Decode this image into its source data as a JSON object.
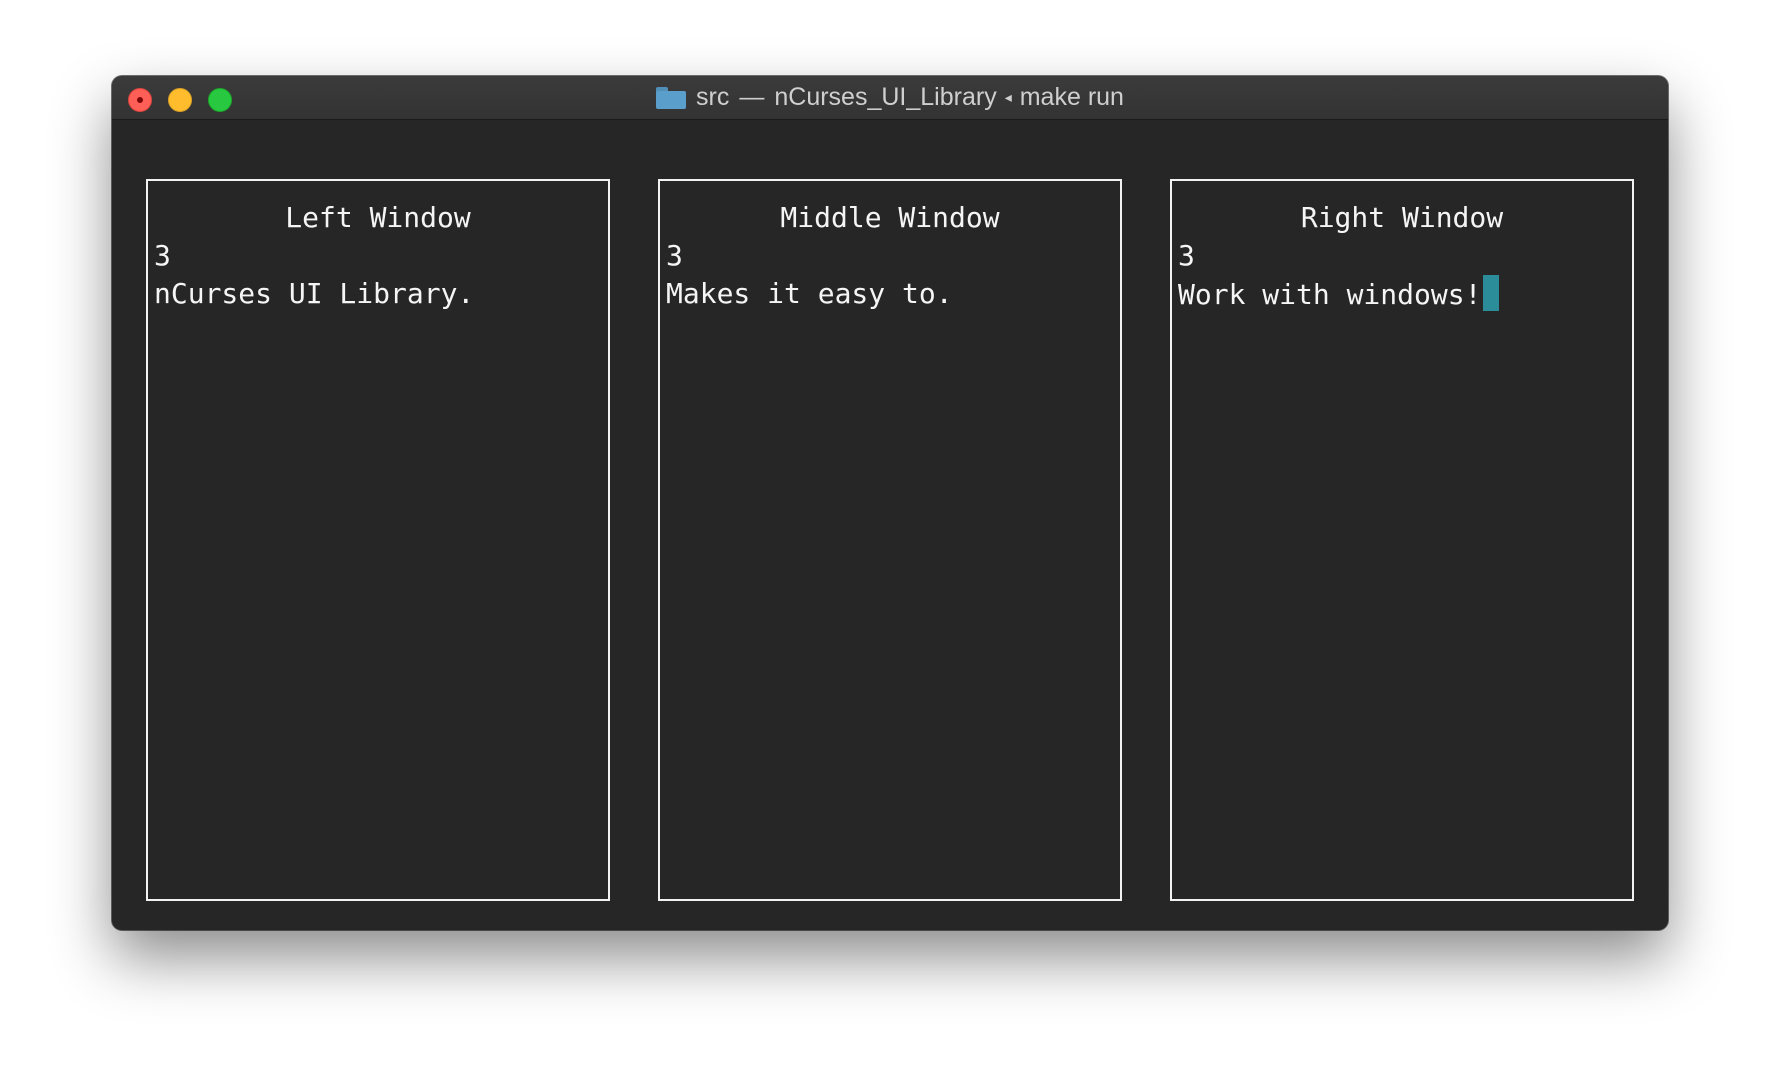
{
  "window": {
    "title_folder": "src",
    "title_separator": "—",
    "title_project": "nCurses_UI_Library",
    "title_caret": "◂",
    "title_command": "make run"
  },
  "panes": {
    "left": {
      "title": "Left Window",
      "count": "3",
      "message": "nCurses UI Library."
    },
    "middle": {
      "title": "Middle Window",
      "count": "3",
      "message": "Makes it easy to."
    },
    "right": {
      "title": "Right Window",
      "count": "3",
      "message": "Work with windows!"
    }
  },
  "colors": {
    "terminal_bg": "#262626",
    "border": "#f2f2f2",
    "cursor": "#2b8c9a",
    "traffic_close": "#ff5f57",
    "traffic_minimize": "#ffbd2e",
    "traffic_zoom": "#28c940"
  },
  "icons": {
    "title_icon": "folder-icon"
  }
}
